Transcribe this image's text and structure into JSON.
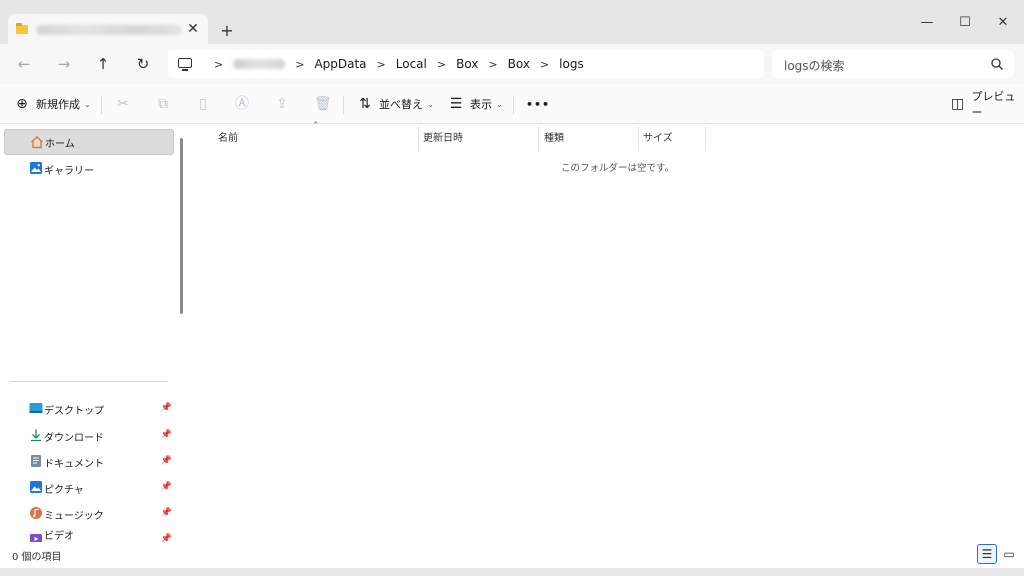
{
  "tab": {
    "title": "",
    "close": "✕",
    "new_tab": "+"
  },
  "window_controls": {
    "minimize": "—",
    "maximize": "☐",
    "close": "✕"
  },
  "nav": {
    "back": "←",
    "forward": "→",
    "up": "↑",
    "refresh": "↻"
  },
  "address": {
    "separator": ">",
    "crumbs": [
      "AppData",
      "Local",
      "Box",
      "Box",
      "logs"
    ]
  },
  "search": {
    "placeholder": "logsの検索"
  },
  "commands": {
    "new": "新規作成",
    "sort": "並べ替え",
    "view": "表示",
    "more": "•••",
    "preview": "プレビュー"
  },
  "sidebar": {
    "top": [
      {
        "label": "ホーム",
        "icon": "home-icon",
        "selected": true
      },
      {
        "label": "ギャラリー",
        "icon": "gallery-icon",
        "selected": false
      }
    ],
    "pinned": [
      {
        "label": "デスクトップ",
        "icon": "desktop-icon"
      },
      {
        "label": "ダウンロード",
        "icon": "download-icon"
      },
      {
        "label": "ドキュメント",
        "icon": "documents-icon"
      },
      {
        "label": "ピクチャ",
        "icon": "pictures-icon"
      },
      {
        "label": "ミュージック",
        "icon": "music-icon"
      },
      {
        "label": "ビデオ",
        "icon": "videos-icon"
      }
    ]
  },
  "columns": {
    "name": "名前",
    "date": "更新日時",
    "type": "種類",
    "size": "サイズ"
  },
  "empty_message": "このフォルダーは空です。",
  "status": {
    "item_count": "0 個の項目"
  },
  "colors": {
    "accent": "#2a6fc9",
    "folder": "#f4c542"
  }
}
